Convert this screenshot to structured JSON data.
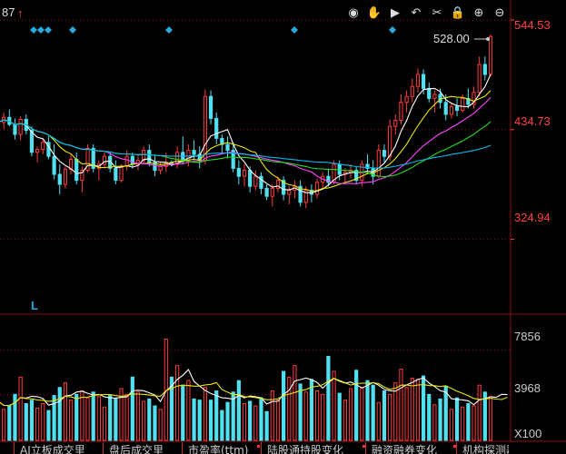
{
  "header": {
    "left_text": "87",
    "arrow": "↑"
  },
  "toolbar": [
    {
      "icon": "eye-icon",
      "glyph": "◉"
    },
    {
      "icon": "hand-icon",
      "glyph": "✋"
    },
    {
      "icon": "play-icon",
      "glyph": "▶"
    },
    {
      "icon": "undo-icon",
      "glyph": "↶"
    },
    {
      "icon": "scissors-icon",
      "glyph": "✂"
    },
    {
      "icon": "lock-icon",
      "glyph": "🔒"
    },
    {
      "icon": "zoom-in-icon",
      "glyph": "⊕"
    },
    {
      "icon": "zoom-out-icon",
      "glyph": "⊖"
    }
  ],
  "colors": {
    "up": "#ff3b3b",
    "down": "#50e0f0",
    "grid": "#8b1010",
    "ma_white": "#ffffff",
    "ma_yellow": "#e8e800",
    "ma_magenta": "#ff44ff",
    "ma_green": "#22dd22",
    "ma_cyan": "#00bbee",
    "axis_price": "#ff4040",
    "axis_volume": "#cccccc",
    "marker": "#2aa8e0"
  },
  "chart_data": {
    "type": "candlestick",
    "price_axis": {
      "ticks": [
        "544.53",
        "434.73",
        "324.94"
      ],
      "ylim": [
        250,
        560
      ]
    },
    "last_price_label": "528.00",
    "ohlc": [
      {
        "o": 439,
        "h": 450,
        "l": 428,
        "c": 442
      },
      {
        "o": 442,
        "h": 452,
        "l": 435,
        "c": 447
      },
      {
        "o": 447,
        "h": 455,
        "l": 438,
        "c": 440
      },
      {
        "o": 440,
        "h": 446,
        "l": 425,
        "c": 430
      },
      {
        "o": 430,
        "h": 448,
        "l": 424,
        "c": 445
      },
      {
        "o": 445,
        "h": 450,
        "l": 430,
        "c": 434
      },
      {
        "o": 434,
        "h": 438,
        "l": 408,
        "c": 412
      },
      {
        "o": 412,
        "h": 418,
        "l": 402,
        "c": 415
      },
      {
        "o": 415,
        "h": 426,
        "l": 410,
        "c": 422
      },
      {
        "o": 422,
        "h": 428,
        "l": 405,
        "c": 408
      },
      {
        "o": 408,
        "h": 420,
        "l": 385,
        "c": 390
      },
      {
        "o": 390,
        "h": 400,
        "l": 370,
        "c": 380
      },
      {
        "o": 380,
        "h": 398,
        "l": 376,
        "c": 395
      },
      {
        "o": 395,
        "h": 410,
        "l": 390,
        "c": 405
      },
      {
        "o": 405,
        "h": 412,
        "l": 380,
        "c": 384
      },
      {
        "o": 384,
        "h": 398,
        "l": 372,
        "c": 394
      },
      {
        "o": 394,
        "h": 420,
        "l": 392,
        "c": 416
      },
      {
        "o": 416,
        "h": 420,
        "l": 392,
        "c": 396
      },
      {
        "o": 396,
        "h": 404,
        "l": 384,
        "c": 400
      },
      {
        "o": 400,
        "h": 412,
        "l": 396,
        "c": 408
      },
      {
        "o": 408,
        "h": 412,
        "l": 392,
        "c": 396
      },
      {
        "o": 396,
        "h": 404,
        "l": 380,
        "c": 384
      },
      {
        "o": 384,
        "h": 400,
        "l": 382,
        "c": 398
      },
      {
        "o": 398,
        "h": 414,
        "l": 394,
        "c": 408
      },
      {
        "o": 408,
        "h": 412,
        "l": 396,
        "c": 400
      },
      {
        "o": 400,
        "h": 410,
        "l": 394,
        "c": 404
      },
      {
        "o": 404,
        "h": 418,
        "l": 400,
        "c": 414
      },
      {
        "o": 414,
        "h": 420,
        "l": 398,
        "c": 402
      },
      {
        "o": 402,
        "h": 410,
        "l": 388,
        "c": 394
      },
      {
        "o": 394,
        "h": 402,
        "l": 390,
        "c": 398
      },
      {
        "o": 398,
        "h": 412,
        "l": 392,
        "c": 402
      },
      {
        "o": 402,
        "h": 404,
        "l": 398,
        "c": 400
      },
      {
        "o": 400,
        "h": 418,
        "l": 396,
        "c": 412
      },
      {
        "o": 412,
        "h": 428,
        "l": 400,
        "c": 404
      },
      {
        "o": 404,
        "h": 420,
        "l": 398,
        "c": 414
      },
      {
        "o": 414,
        "h": 424,
        "l": 404,
        "c": 410
      },
      {
        "o": 410,
        "h": 418,
        "l": 396,
        "c": 404
      },
      {
        "o": 404,
        "h": 475,
        "l": 400,
        "c": 468
      },
      {
        "o": 468,
        "h": 474,
        "l": 440,
        "c": 446
      },
      {
        "o": 446,
        "h": 452,
        "l": 420,
        "c": 426
      },
      {
        "o": 426,
        "h": 430,
        "l": 410,
        "c": 420
      },
      {
        "o": 420,
        "h": 428,
        "l": 406,
        "c": 414
      },
      {
        "o": 414,
        "h": 422,
        "l": 392,
        "c": 396
      },
      {
        "o": 396,
        "h": 404,
        "l": 380,
        "c": 388
      },
      {
        "o": 388,
        "h": 400,
        "l": 378,
        "c": 394
      },
      {
        "o": 394,
        "h": 398,
        "l": 372,
        "c": 378
      },
      {
        "o": 378,
        "h": 394,
        "l": 374,
        "c": 388
      },
      {
        "o": 388,
        "h": 392,
        "l": 370,
        "c": 376
      },
      {
        "o": 376,
        "h": 380,
        "l": 364,
        "c": 368
      },
      {
        "o": 368,
        "h": 380,
        "l": 358,
        "c": 376
      },
      {
        "o": 376,
        "h": 388,
        "l": 372,
        "c": 384
      },
      {
        "o": 384,
        "h": 388,
        "l": 364,
        "c": 370
      },
      {
        "o": 370,
        "h": 378,
        "l": 360,
        "c": 374
      },
      {
        "o": 374,
        "h": 384,
        "l": 366,
        "c": 378
      },
      {
        "o": 378,
        "h": 384,
        "l": 358,
        "c": 362
      },
      {
        "o": 362,
        "h": 378,
        "l": 356,
        "c": 374
      },
      {
        "o": 374,
        "h": 380,
        "l": 362,
        "c": 370
      },
      {
        "o": 370,
        "h": 386,
        "l": 366,
        "c": 382
      },
      {
        "o": 382,
        "h": 392,
        "l": 376,
        "c": 388
      },
      {
        "o": 388,
        "h": 396,
        "l": 378,
        "c": 382
      },
      {
        "o": 382,
        "h": 404,
        "l": 380,
        "c": 400
      },
      {
        "o": 400,
        "h": 404,
        "l": 384,
        "c": 390
      },
      {
        "o": 390,
        "h": 396,
        "l": 382,
        "c": 392
      },
      {
        "o": 392,
        "h": 400,
        "l": 386,
        "c": 394
      },
      {
        "o": 394,
        "h": 398,
        "l": 380,
        "c": 384
      },
      {
        "o": 384,
        "h": 404,
        "l": 378,
        "c": 400
      },
      {
        "o": 400,
        "h": 410,
        "l": 390,
        "c": 396
      },
      {
        "o": 396,
        "h": 404,
        "l": 380,
        "c": 388
      },
      {
        "o": 388,
        "h": 420,
        "l": 386,
        "c": 414
      },
      {
        "o": 414,
        "h": 420,
        "l": 402,
        "c": 408
      },
      {
        "o": 408,
        "h": 445,
        "l": 404,
        "c": 438
      },
      {
        "o": 438,
        "h": 450,
        "l": 430,
        "c": 444
      },
      {
        "o": 444,
        "h": 470,
        "l": 440,
        "c": 462
      },
      {
        "o": 462,
        "h": 474,
        "l": 452,
        "c": 468
      },
      {
        "o": 468,
        "h": 486,
        "l": 462,
        "c": 478
      },
      {
        "o": 478,
        "h": 496,
        "l": 472,
        "c": 490
      },
      {
        "o": 490,
        "h": 495,
        "l": 470,
        "c": 476
      },
      {
        "o": 476,
        "h": 482,
        "l": 462,
        "c": 466
      },
      {
        "o": 466,
        "h": 474,
        "l": 452,
        "c": 470
      },
      {
        "o": 470,
        "h": 476,
        "l": 456,
        "c": 462
      },
      {
        "o": 462,
        "h": 470,
        "l": 444,
        "c": 450
      },
      {
        "o": 450,
        "h": 462,
        "l": 446,
        "c": 458
      },
      {
        "o": 458,
        "h": 466,
        "l": 448,
        "c": 454
      },
      {
        "o": 454,
        "h": 470,
        "l": 452,
        "c": 466
      },
      {
        "o": 466,
        "h": 476,
        "l": 456,
        "c": 460
      },
      {
        "o": 460,
        "h": 478,
        "l": 456,
        "c": 472
      },
      {
        "o": 472,
        "h": 508,
        "l": 468,
        "c": 500
      },
      {
        "o": 500,
        "h": 508,
        "l": 484,
        "c": 490
      },
      {
        "o": 490,
        "h": 530,
        "l": 488,
        "c": 528
      }
    ],
    "volume_axis": {
      "ticks": [
        "7856",
        "3968"
      ],
      "unit_label": "X100",
      "ylim": [
        0,
        10500
      ]
    },
    "volume": [
      3400,
      2700,
      3000,
      4000,
      5500,
      3200,
      3500,
      2800,
      3200,
      2600,
      3900,
      4600,
      5000,
      3500,
      4000,
      4300,
      3700,
      4200,
      3800,
      2900,
      3900,
      3600,
      4500,
      4000,
      5500,
      4200,
      3400,
      3600,
      3000,
      2700,
      8800,
      5500,
      6500,
      4800,
      5200,
      3600,
      3500,
      4600,
      3500,
      4300,
      2600,
      3300,
      4200,
      5200,
      3200,
      3400,
      3000,
      3700,
      2500,
      4300,
      3500,
      6000,
      5500,
      6500,
      4900,
      4200,
      5300,
      4300,
      4000,
      7300,
      6000,
      4100,
      3500,
      4500,
      6100,
      4600,
      5200,
      4800,
      3300,
      4300,
      4000,
      5000,
      6200,
      4600,
      5400,
      5300,
      5600,
      4000,
      3100,
      3600,
      4700,
      2700,
      3700,
      2900,
      3200,
      3000,
      4800,
      4200,
      3800,
      2900,
      4300,
      4700
    ],
    "markers": {
      "diamond_x": [
        37,
        45,
        53,
        80,
        186,
        324,
        432
      ],
      "L_label": "L"
    },
    "tabs": [
      "AI立板成交里",
      "盘后成交里",
      "市盈率(ttm)",
      "陆股通持股变化",
      "融资融券变化",
      "机构探测器"
    ]
  }
}
